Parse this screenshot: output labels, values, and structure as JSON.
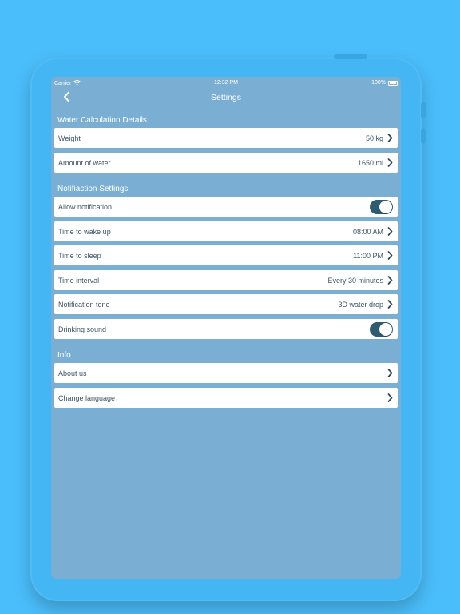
{
  "status_bar": {
    "carrier": "Carrier",
    "time": "12:32 PM",
    "battery": "100%"
  },
  "nav": {
    "title": "Settings",
    "back_icon": "chevron-left-icon"
  },
  "sections": {
    "water": {
      "header": "Water Calculation Details",
      "weight": {
        "label": "Weight",
        "value": "50 kg"
      },
      "amount": {
        "label": "Amount of water",
        "value": "1650 ml"
      }
    },
    "notification": {
      "header": "Notifiaction Settings",
      "allow": {
        "label": "Allow notification",
        "enabled": true
      },
      "wake": {
        "label": "Time to wake up",
        "value": "08:00 AM"
      },
      "sleep": {
        "label": "Time to sleep",
        "value": "11:00 PM"
      },
      "interval": {
        "label": "Time interval",
        "value": "Every 30 minutes"
      },
      "tone": {
        "label": "Notification tone",
        "value": "3D water drop"
      },
      "drinking": {
        "label": "Drinking sound",
        "enabled": true
      }
    },
    "info": {
      "header": "Info",
      "about": {
        "label": "About us"
      },
      "language": {
        "label": "Change language"
      }
    }
  },
  "colors": {
    "background": "#4ABEFB",
    "screen": "#7AAFD3",
    "row": "#FFFFFF",
    "text": "#3D5566",
    "toggle_on": "#2E5B70"
  }
}
